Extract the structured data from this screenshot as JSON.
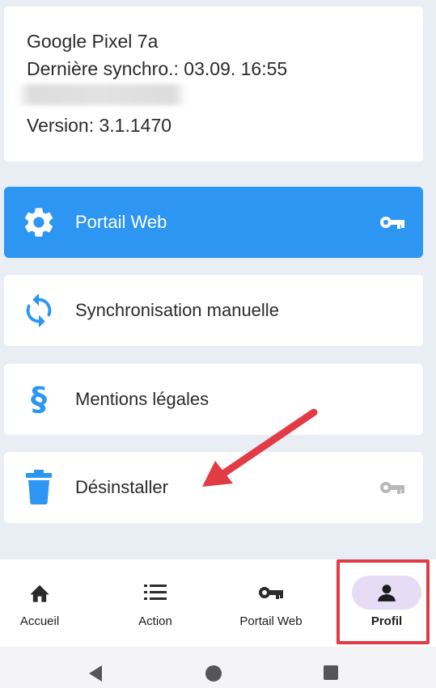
{
  "device_info": {
    "device_name": "Google Pixel 7a",
    "last_sync": "Dernière synchro.: 03.09. 16:55",
    "version": "Version: 3.1.1470"
  },
  "menu": {
    "portal": {
      "label": "Portail Web",
      "icon": "gear-icon",
      "trail_icon": "key-icon"
    },
    "sync": {
      "label": "Synchronisation manuelle",
      "icon": "sync-icon"
    },
    "legal": {
      "label": "Mentions légales",
      "icon": "section-sign-icon",
      "glyph": "§"
    },
    "uninstall": {
      "label": "Désinstaller",
      "icon": "trash-icon",
      "trail_icon": "key-icon"
    }
  },
  "bottom_nav": {
    "items": [
      {
        "label": "Accueil",
        "icon": "home-icon"
      },
      {
        "label": "Action",
        "icon": "list-icon"
      },
      {
        "label": "Portail Web",
        "icon": "key-icon"
      },
      {
        "label": "Profil",
        "icon": "person-icon",
        "selected": true
      }
    ]
  },
  "colors": {
    "accent": "#2d96f2",
    "background": "#e9edf4",
    "annotation": "#e23b45",
    "selected_pill": "#e7dcf5"
  }
}
